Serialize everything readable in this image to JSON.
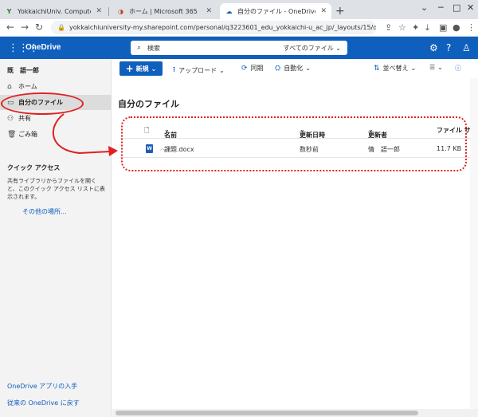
{
  "browser": {
    "tabs": [
      {
        "title": "YokkaichiUniv. ComputerCenter",
        "favicon": "Y"
      },
      {
        "title": "ホーム | Microsoft 365",
        "favicon": "365"
      },
      {
        "title": "自分のファイル - OneDrive",
        "favicon": "cloud"
      }
    ],
    "url": "yokkaichiuniversity-my.sharepoint.com/personal/q3223601_edu_yokkaichi-u_ac_jp/_layouts/15/onedrive.a..."
  },
  "suite": {
    "app_name": "OneDrive",
    "search_placeholder": "検索",
    "search_scope": "すべてのファイル"
  },
  "nav": {
    "user_name": "既　語一郎",
    "items": [
      {
        "label": "ホーム",
        "icon": "home-icon"
      },
      {
        "label": "自分のファイル",
        "icon": "folder-icon"
      },
      {
        "label": "共有",
        "icon": "people-icon"
      },
      {
        "label": "ごみ箱",
        "icon": "trash-icon"
      }
    ],
    "quick_access_title": "クイック アクセス",
    "quick_access_desc": "共有ライブラリからファイルを開くと、このクイック アクセス リストに表示されます。",
    "other_places": "その他の場所...",
    "get_app": "OneDrive アプリの入手",
    "classic": "従来の OneDrive に戻す"
  },
  "commands": {
    "new": "新規",
    "upload": "アップロード",
    "sync": "同期",
    "automate": "自動化",
    "sort": "並べ替え"
  },
  "main": {
    "title": "自分のファイル",
    "columns": {
      "name": "名前",
      "modified": "更新日時",
      "modified_by": "更新者",
      "size": "ファイル サ"
    },
    "files": [
      {
        "name": "課題.docx",
        "modified": "数秒前",
        "modified_by": "情　語一郎",
        "size": "11.7 KB"
      }
    ]
  },
  "colors": {
    "brand": "#0f5fbd",
    "annotation": "#e02020"
  }
}
